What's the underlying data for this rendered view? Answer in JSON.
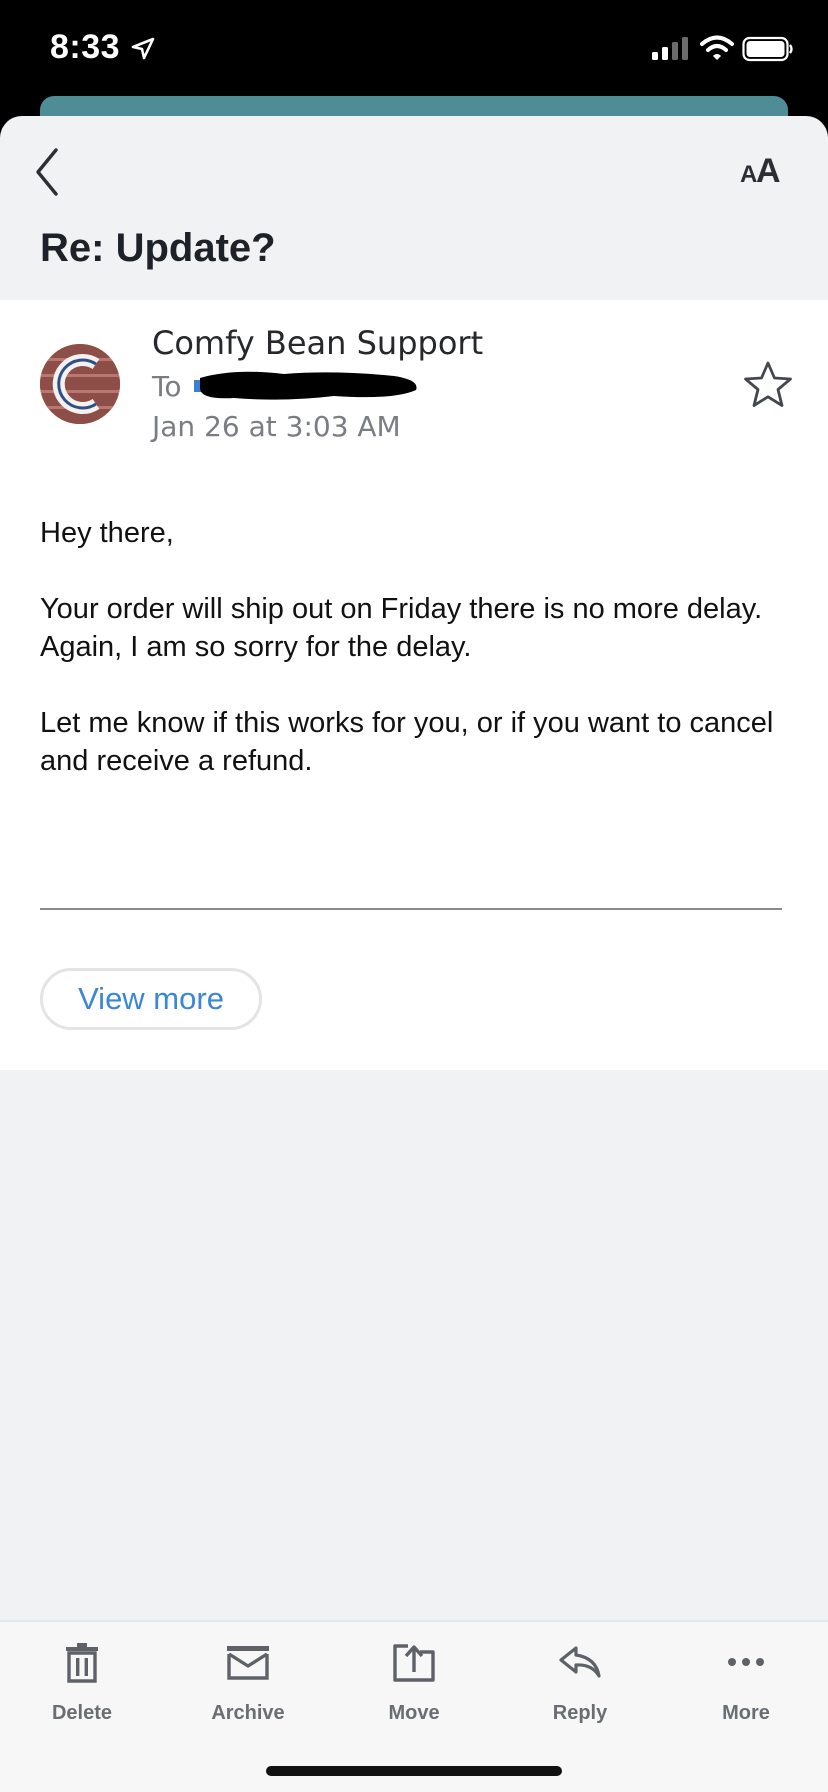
{
  "status_bar": {
    "time": "8:33"
  },
  "header": {
    "subject": "Re: Update?"
  },
  "message": {
    "sender": "Comfy Bean Support",
    "to_label": "To",
    "date": "Jan 26 at 3:03 AM",
    "body": [
      "Hey there,",
      "Your order will ship out on Friday there is no more delay. Again, I am so sorry for the delay.",
      "Let me know if this works for you, or if you want to cancel and receive a refund."
    ],
    "view_more_label": "View more"
  },
  "toolbar": {
    "items": [
      {
        "label": "Delete",
        "icon": "trash-icon"
      },
      {
        "label": "Archive",
        "icon": "archive-icon"
      },
      {
        "label": "Move",
        "icon": "move-icon"
      },
      {
        "label": "Reply",
        "icon": "reply-icon"
      },
      {
        "label": "More",
        "icon": "more-icon"
      }
    ]
  },
  "colors": {
    "accent_link": "#3a87d8",
    "sheet_background": "#f1f2f4",
    "header_strip": "#4e8c96"
  }
}
